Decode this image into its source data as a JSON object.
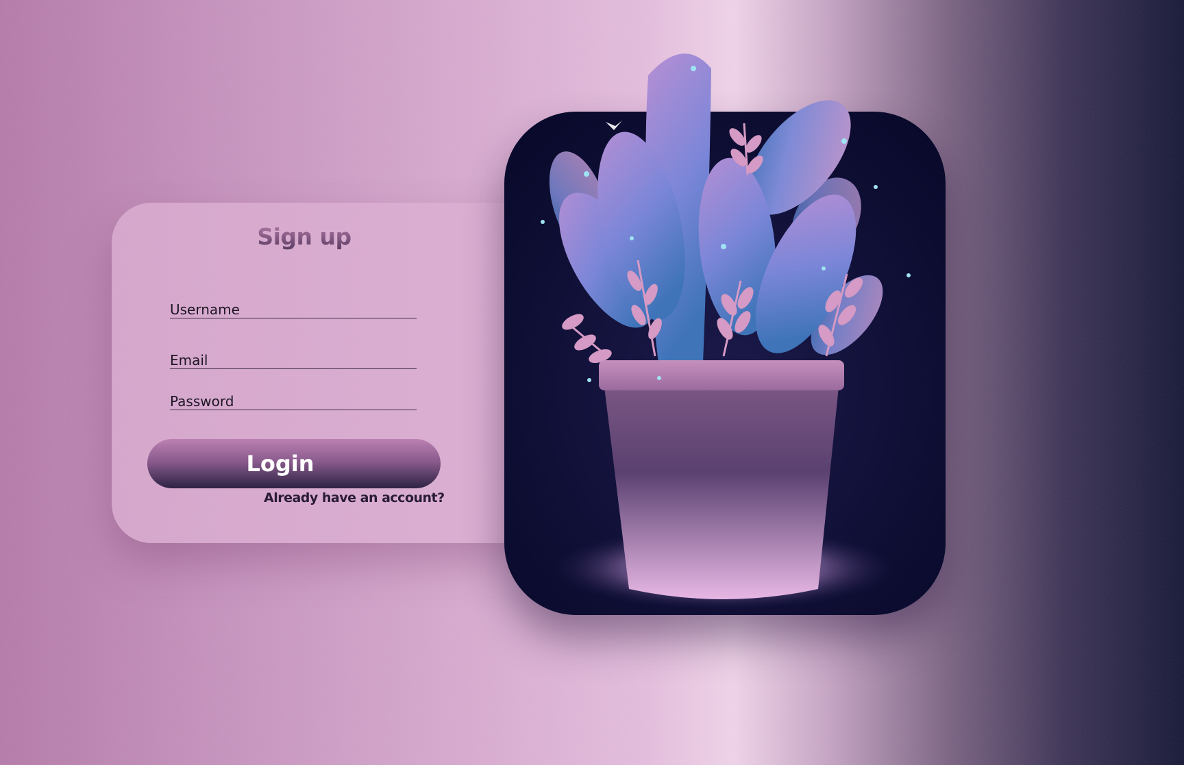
{
  "signup": {
    "title": "Sign up",
    "username_placeholder": "Username",
    "email_placeholder": "Email",
    "password_placeholder": "Password",
    "login_label": "Login",
    "account_link": "Already have an account?"
  },
  "colors": {
    "accent": "#b37aa7",
    "dark": "#2d2244",
    "card": "#dbb0d2"
  },
  "illustration": {
    "icon": "potted-plant-illustration"
  }
}
